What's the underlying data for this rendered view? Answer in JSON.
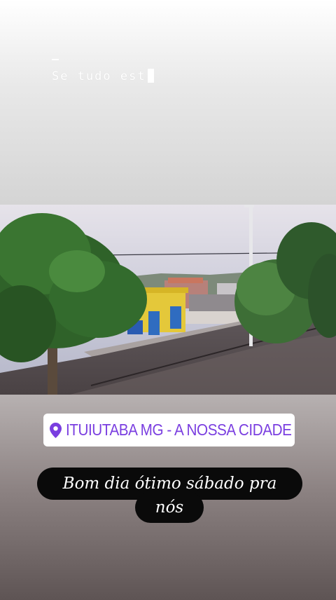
{
  "story": {
    "typed_text": "Se tudo est",
    "location": {
      "label": "ITUIUTABA MG - A NOSSA CIDADE",
      "icon": "location-pin-icon",
      "color": "#7a3ee0"
    },
    "caption_lines": [
      "Bom dia ótimo sábado pra",
      "nós"
    ]
  }
}
